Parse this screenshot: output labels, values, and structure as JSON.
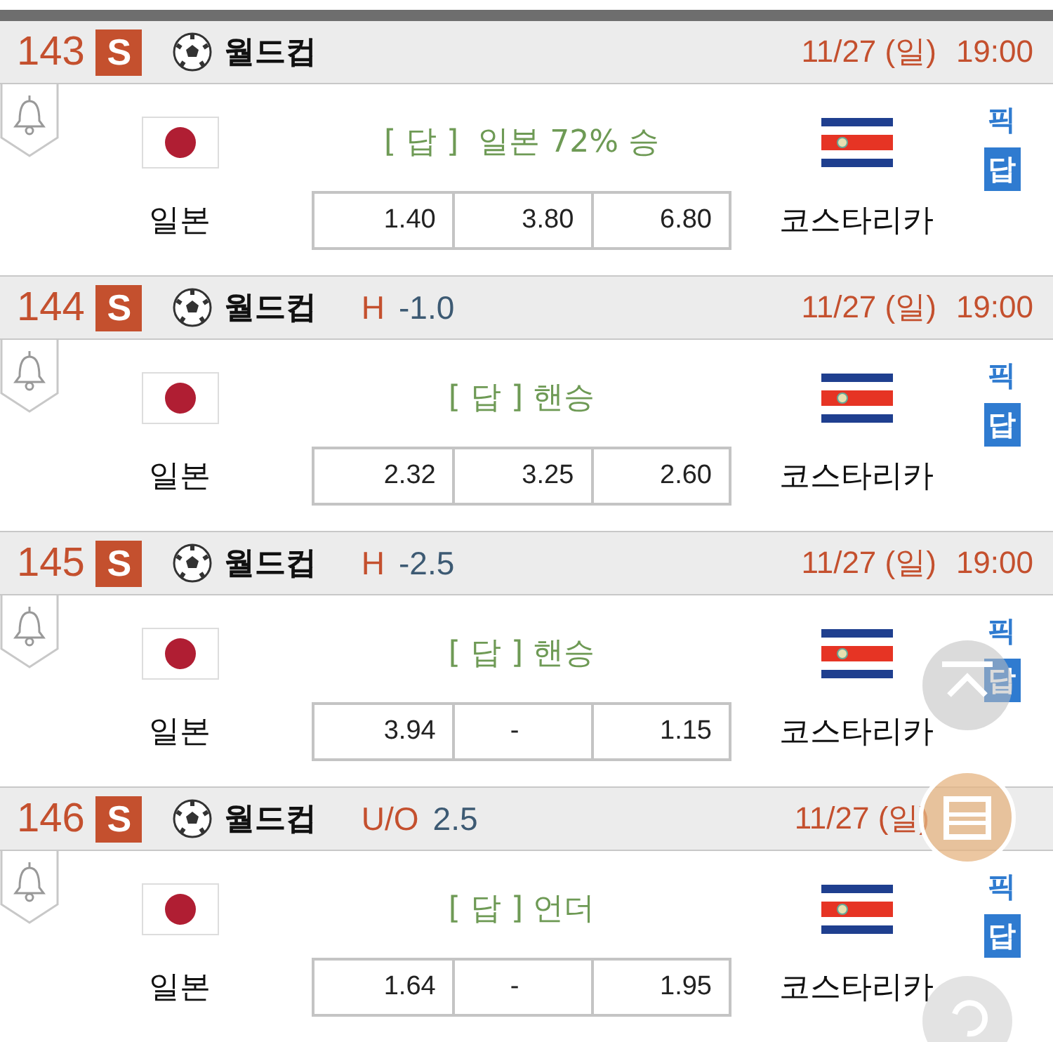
{
  "matches": [
    {
      "number": "143",
      "badge": "S",
      "league": "월드컵",
      "date": "11/27 (일)",
      "time": "19:00",
      "home": "일본",
      "away": "코스타리카",
      "answer": "[ 답 ]  일본 72% 승",
      "odds": [
        "1.40",
        "3.80",
        "6.80"
      ],
      "pick": "픽",
      "answer_badge": "답"
    },
    {
      "number": "144",
      "badge": "S",
      "league": "월드컵",
      "handicap": {
        "label": "H",
        "value": "-1.0"
      },
      "date": "11/27 (일)",
      "time": "19:00",
      "home": "일본",
      "away": "코스타리카",
      "answer": "[ 답 ] 핸승",
      "odds": [
        "2.32",
        "3.25",
        "2.60"
      ],
      "pick": "픽",
      "answer_badge": "답"
    },
    {
      "number": "145",
      "badge": "S",
      "league": "월드컵",
      "handicap": {
        "label": "H",
        "value": "-2.5"
      },
      "date": "11/27 (일)",
      "time": "19:00",
      "home": "일본",
      "away": "코스타리카",
      "answer": "[ 답 ] 핸승",
      "odds": [
        "3.94",
        "-",
        "1.15"
      ],
      "pick": "픽",
      "answer_badge": "답"
    },
    {
      "number": "146",
      "badge": "S",
      "league": "월드컵",
      "handicap": {
        "label": "U/O",
        "value": "2.5"
      },
      "date": "11/27 (일)",
      "home": "일본",
      "away": "코스타리카",
      "answer": "[ 답 ] 언더",
      "odds": [
        "1.64",
        "-",
        "1.95"
      ],
      "pick": "픽",
      "answer_badge": "답"
    }
  ]
}
